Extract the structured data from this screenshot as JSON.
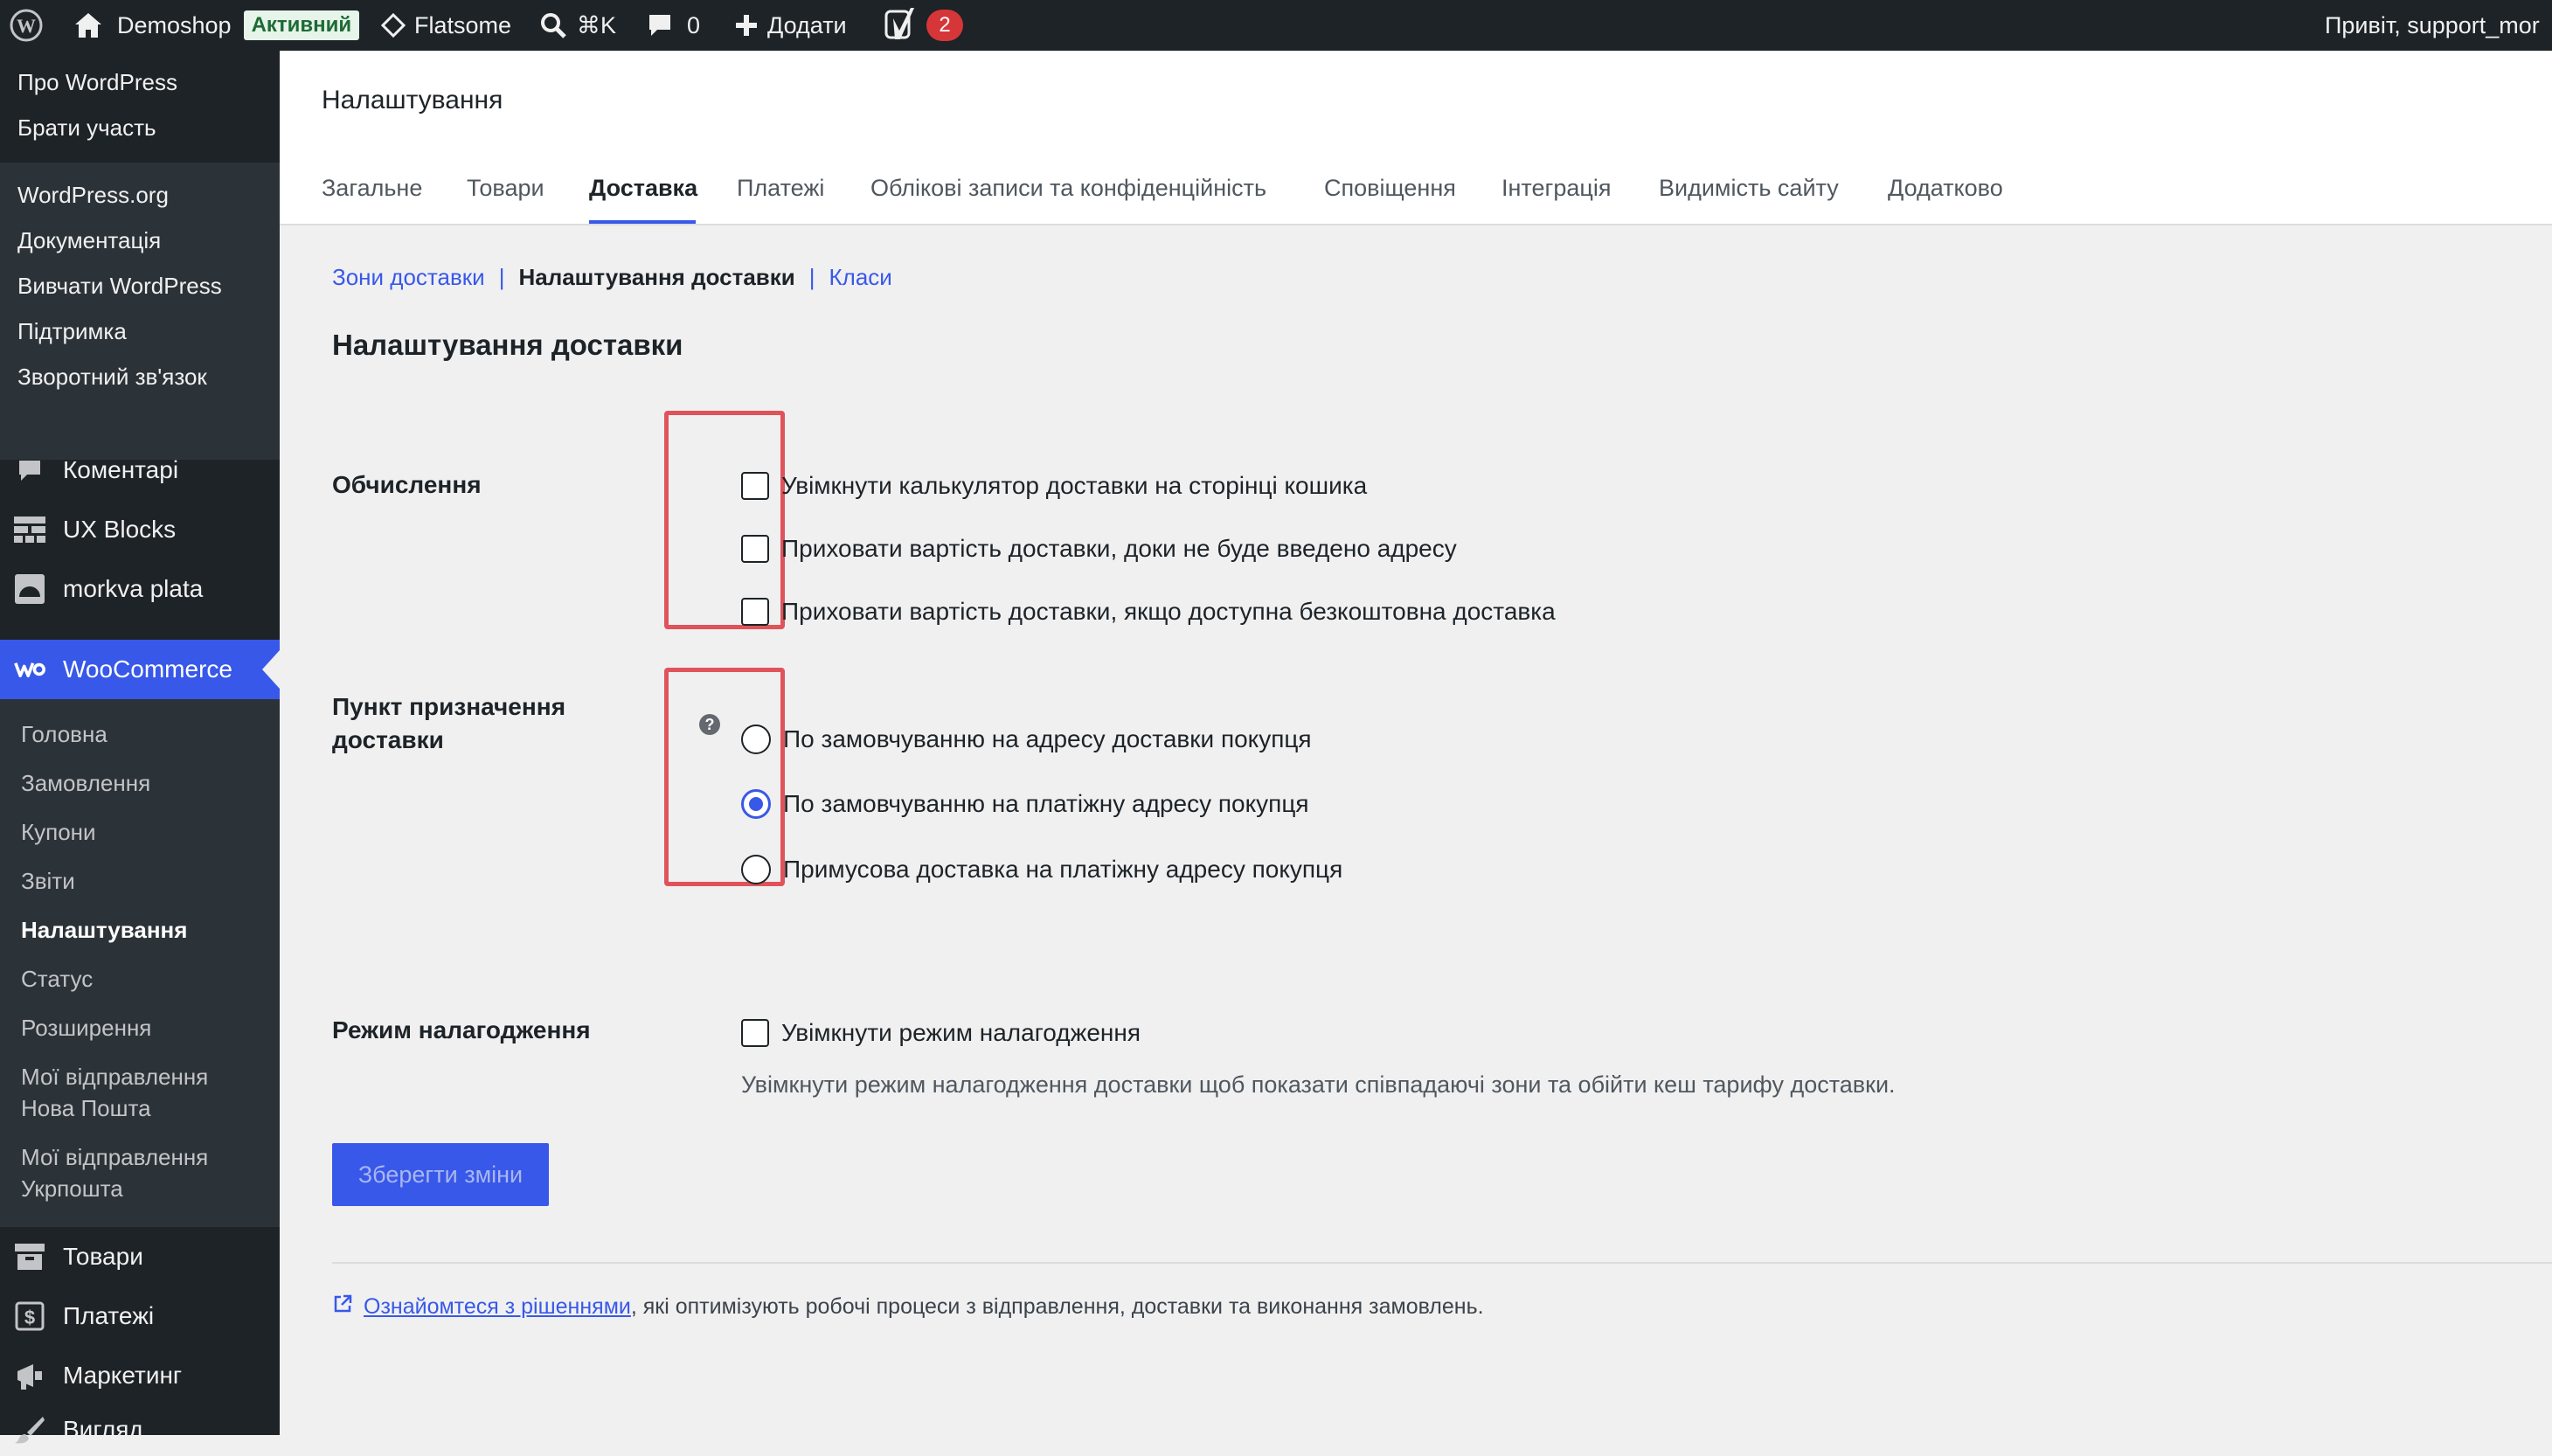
{
  "adminbar": {
    "site_name": "Demoshop",
    "status_badge": "Активний",
    "theme": "Flatsome",
    "shortcut": "⌘K",
    "comments_count": "0",
    "add_new": "Додати",
    "yoast_count": "2",
    "greeting": "Привіт, support_mor"
  },
  "sidebar": {
    "about_menu": [
      "Про WordPress",
      "Брати участь"
    ],
    "links_menu": [
      "WordPress.org",
      "Документація",
      "Вивчати WordPress",
      "Підтримка",
      "Зворотний зв'язок"
    ],
    "comments": "Коментарі",
    "ux_blocks": "UX Blocks",
    "morkva": "morkva plata",
    "woocommerce": "WooCommerce",
    "woo_sub": {
      "home": "Головна",
      "orders": "Замовлення",
      "coupons": "Купони",
      "reports": "Звіти",
      "settings": "Налаштування",
      "status": "Статус",
      "extensions": "Розширення",
      "np_line1": "Мої відправлення",
      "np_line2": "Нова Пошта",
      "up_line1": "Мої відправлення",
      "up_line2": "Укрпошта"
    },
    "products": "Товари",
    "payments": "Платежі",
    "marketing": "Маркетинг",
    "appearance": "Вигляд"
  },
  "header": {
    "title": "Налаштування",
    "tabs": [
      "Загальне",
      "Товари",
      "Доставка",
      "Платежі",
      "Облікові записи та конфіденційність",
      "Сповіщення",
      "Інтеграція",
      "Видимість сайту",
      "Додатково"
    ],
    "active_tab": "Доставка"
  },
  "subnav": {
    "zones": "Зони доставки",
    "options": "Налаштування доставки",
    "classes": "Класи",
    "separator": "|"
  },
  "section_title": "Налаштування доставки",
  "calculations": {
    "label": "Обчислення",
    "options": [
      {
        "label": "Увімкнути калькулятор доставки на сторінці кошика",
        "checked": false
      },
      {
        "label": "Приховати вартість доставки, доки не буде введено адресу",
        "checked": false
      },
      {
        "label": "Приховати вартість доставки, якщо доступна безкоштовна доставка",
        "checked": false
      }
    ]
  },
  "destination": {
    "label_line1": "Пункт призначення",
    "label_line2": "доставки",
    "help": "?",
    "options": [
      {
        "label": "По замовчуванню на адресу доставки покупця",
        "selected": false
      },
      {
        "label": "По замовчуванню на платіжну адресу покупця",
        "selected": true
      },
      {
        "label": "Примусова доставка на платіжну адресу покупця",
        "selected": false
      }
    ]
  },
  "debug": {
    "label": "Режим налагодження",
    "checkbox_label": "Увімкнути режим налагодження",
    "checked": false,
    "description": "Увімкнути режим налагодження доставки щоб показати співпадаючі зони та обійти кеш тарифу доставки."
  },
  "save_button": "Зберегти зміни",
  "footer": {
    "link": "Ознайомтеся з рішеннями",
    "text": ", які оптимізують робочі процеси з відправлення, доставки та виконання замовлень."
  },
  "colors": {
    "accent": "#3858e9",
    "admin_bg": "#1d2327",
    "highlight_box": "#e0535a"
  }
}
